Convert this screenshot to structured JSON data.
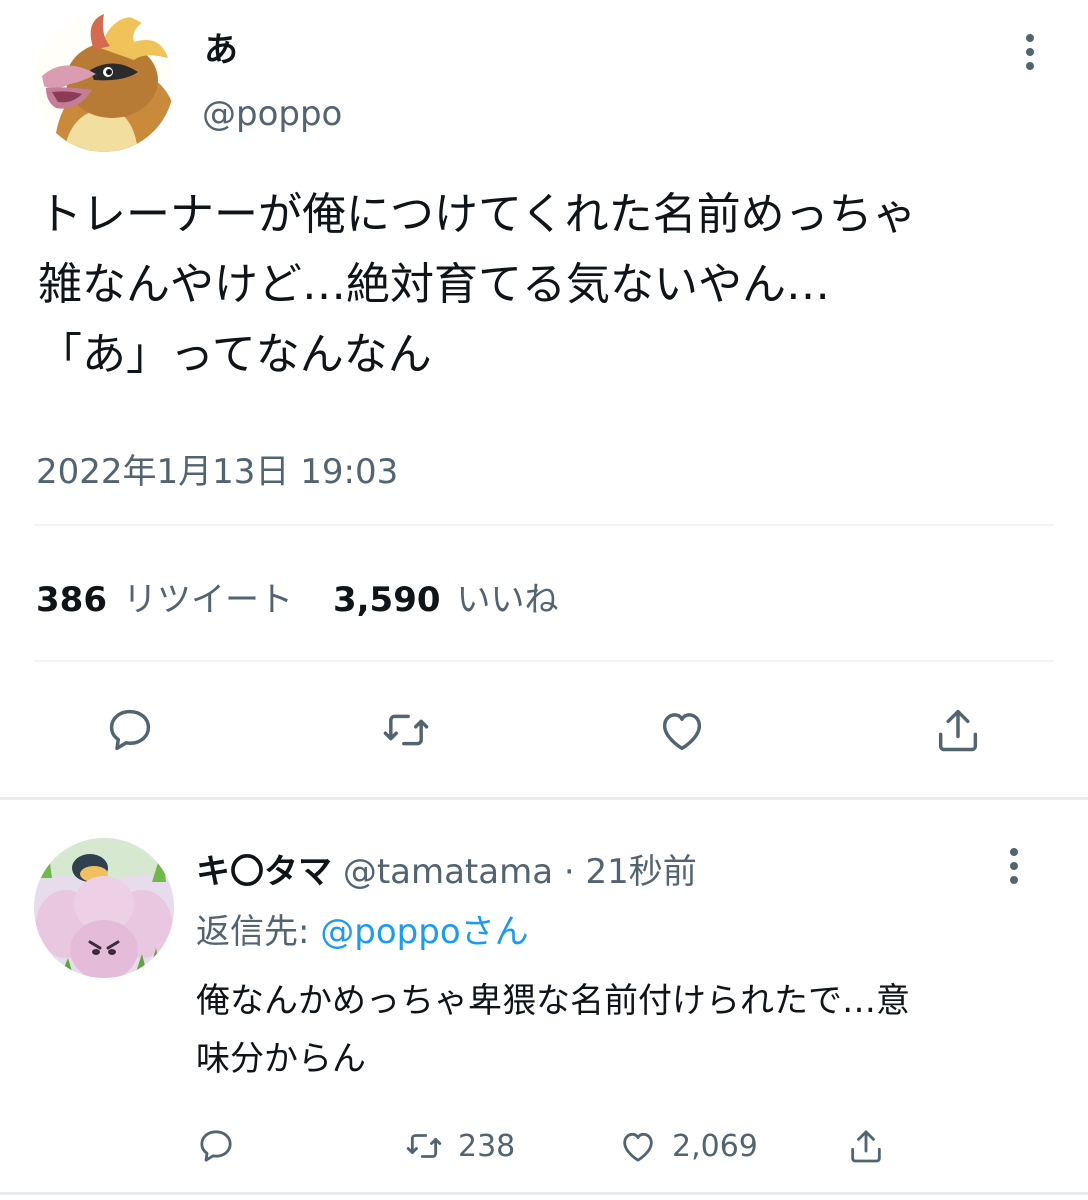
{
  "main_tweet": {
    "display_name": "あ",
    "handle": "@poppo",
    "text": "トレーナーが俺につけてくれた名前めっちゃ\n雑なんやけど…絶対育てる気ないやん…\n「あ」ってなんなん",
    "timestamp": "2022年1月13日 19:03",
    "retweets_count": "386",
    "retweets_label": "リツイート",
    "likes_count": "3,590",
    "likes_label": "いいね",
    "avatar_icon": "pidgeotto-avatar",
    "actions": [
      "reply-icon",
      "retweet-icon",
      "like-icon",
      "share-icon"
    ]
  },
  "reply_tweet": {
    "display_name": "キ〇タマ",
    "handle": "@tamatama",
    "separator": "·",
    "time_ago": "21秒前",
    "replying_prefix": "返信先: ",
    "replying_to": "@poppoさん",
    "text": "俺なんかめっちゃ卑猥な名前付けられたで…意\n味分からん",
    "retweets_count": "238",
    "likes_count": "2,069",
    "avatar_icon": "exeggcute-avatar"
  },
  "colors": {
    "primary_text": "#0f1419",
    "secondary_text": "#536471",
    "link": "#1d9bf0",
    "divider": "#eff3f4"
  }
}
